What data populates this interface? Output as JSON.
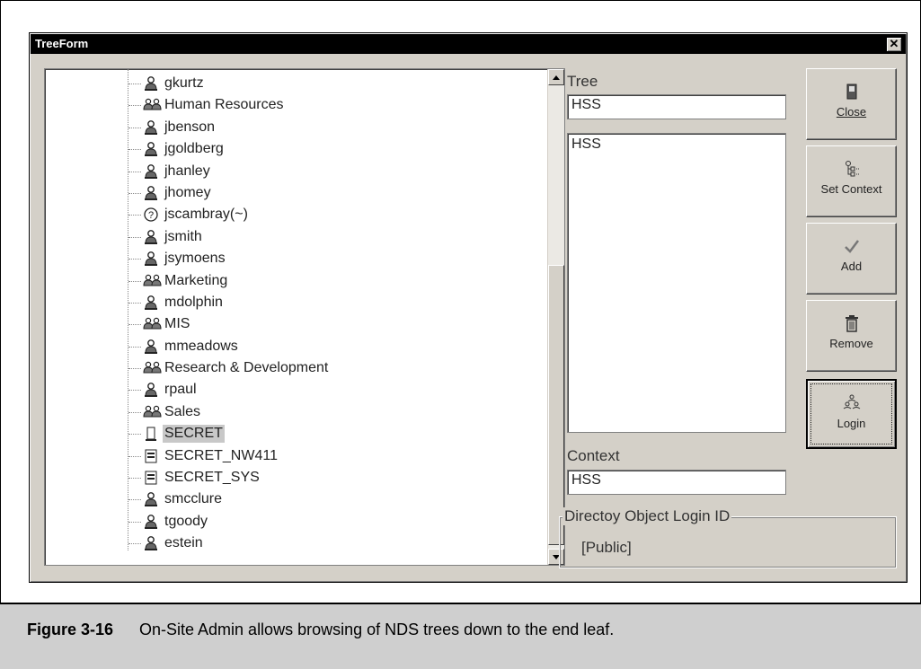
{
  "window": {
    "title": "TreeForm",
    "close_glyph": "✕"
  },
  "tree": {
    "items": [
      {
        "label": "gkurtz",
        "icon": "user-icon"
      },
      {
        "label": "Human Resources",
        "icon": "group-icon"
      },
      {
        "label": "jbenson",
        "icon": "user-icon"
      },
      {
        "label": "jgoldberg",
        "icon": "user-icon"
      },
      {
        "label": "jhanley",
        "icon": "user-icon"
      },
      {
        "label": "jhomey",
        "icon": "user-icon"
      },
      {
        "label": "jscambray(~)",
        "icon": "unknown-object-icon"
      },
      {
        "label": "jsmith",
        "icon": "user-icon"
      },
      {
        "label": "jsymoens",
        "icon": "user-icon"
      },
      {
        "label": "Marketing",
        "icon": "group-icon"
      },
      {
        "label": "mdolphin",
        "icon": "user-icon"
      },
      {
        "label": "MIS",
        "icon": "group-icon"
      },
      {
        "label": "mmeadows",
        "icon": "user-icon"
      },
      {
        "label": "Research & Development",
        "icon": "group-icon"
      },
      {
        "label": "rpaul",
        "icon": "user-icon"
      },
      {
        "label": "Sales",
        "icon": "group-icon"
      },
      {
        "label": "SECRET",
        "icon": "volume-icon",
        "selected": true
      },
      {
        "label": "SECRET_NW411",
        "icon": "server-icon"
      },
      {
        "label": "SECRET_SYS",
        "icon": "server-icon"
      },
      {
        "label": "smcclure",
        "icon": "user-icon"
      },
      {
        "label": "tgoody",
        "icon": "user-icon"
      },
      {
        "label": "estein",
        "icon": "user-icon"
      }
    ]
  },
  "tree_field": {
    "label": "Tree",
    "value": "HSS"
  },
  "tree_list": {
    "items": [
      "HSS"
    ]
  },
  "context_field": {
    "label": "Context",
    "value": "HSS"
  },
  "login_group": {
    "title": "Directoy Object Login ID",
    "value": "[Public]"
  },
  "buttons": {
    "close": {
      "label": "Close",
      "icon": "door-icon"
    },
    "set_context": {
      "label": "Set Context",
      "icon": "tree-icon"
    },
    "add": {
      "label": "Add",
      "icon": "checkmark-icon"
    },
    "remove": {
      "label": "Remove",
      "icon": "trash-icon"
    },
    "login": {
      "label": "Login",
      "icon": "network-users-icon"
    }
  },
  "caption": {
    "figure_number": "Figure 3-16",
    "text": "On-Site Admin allows browsing of NDS trees down to the end leaf."
  }
}
